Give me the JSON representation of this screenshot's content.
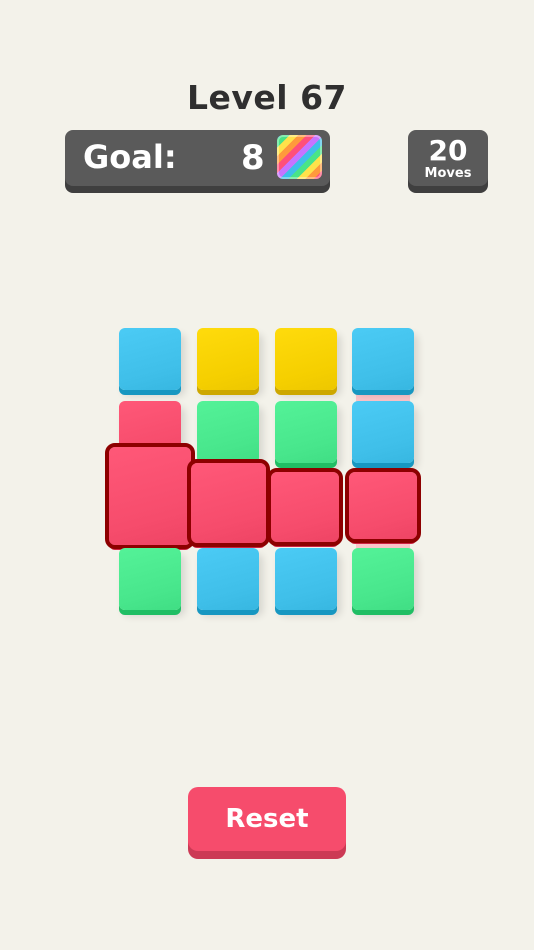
{
  "level": {
    "title": "Level 67"
  },
  "goal": {
    "label": "Goal:",
    "count": "8",
    "icon": "rainbow-tile-icon"
  },
  "moves": {
    "count": "20",
    "label": "Moves"
  },
  "colors": {
    "blue": "#3fbfe9",
    "yellow": "#f5cf00",
    "red": "#f64c6c",
    "green": "#48e68c",
    "selected_outline": "#8d0000"
  },
  "board": {
    "rows": [
      [
        "blue",
        "yellow",
        "yellow",
        "blue"
      ],
      [
        "red",
        "green",
        "green",
        "blue"
      ],
      [
        "red",
        "red",
        "red",
        "red"
      ],
      [
        "green",
        "blue",
        "blue",
        "green"
      ]
    ],
    "selected_row": 2
  },
  "reset": {
    "label": "Reset"
  }
}
